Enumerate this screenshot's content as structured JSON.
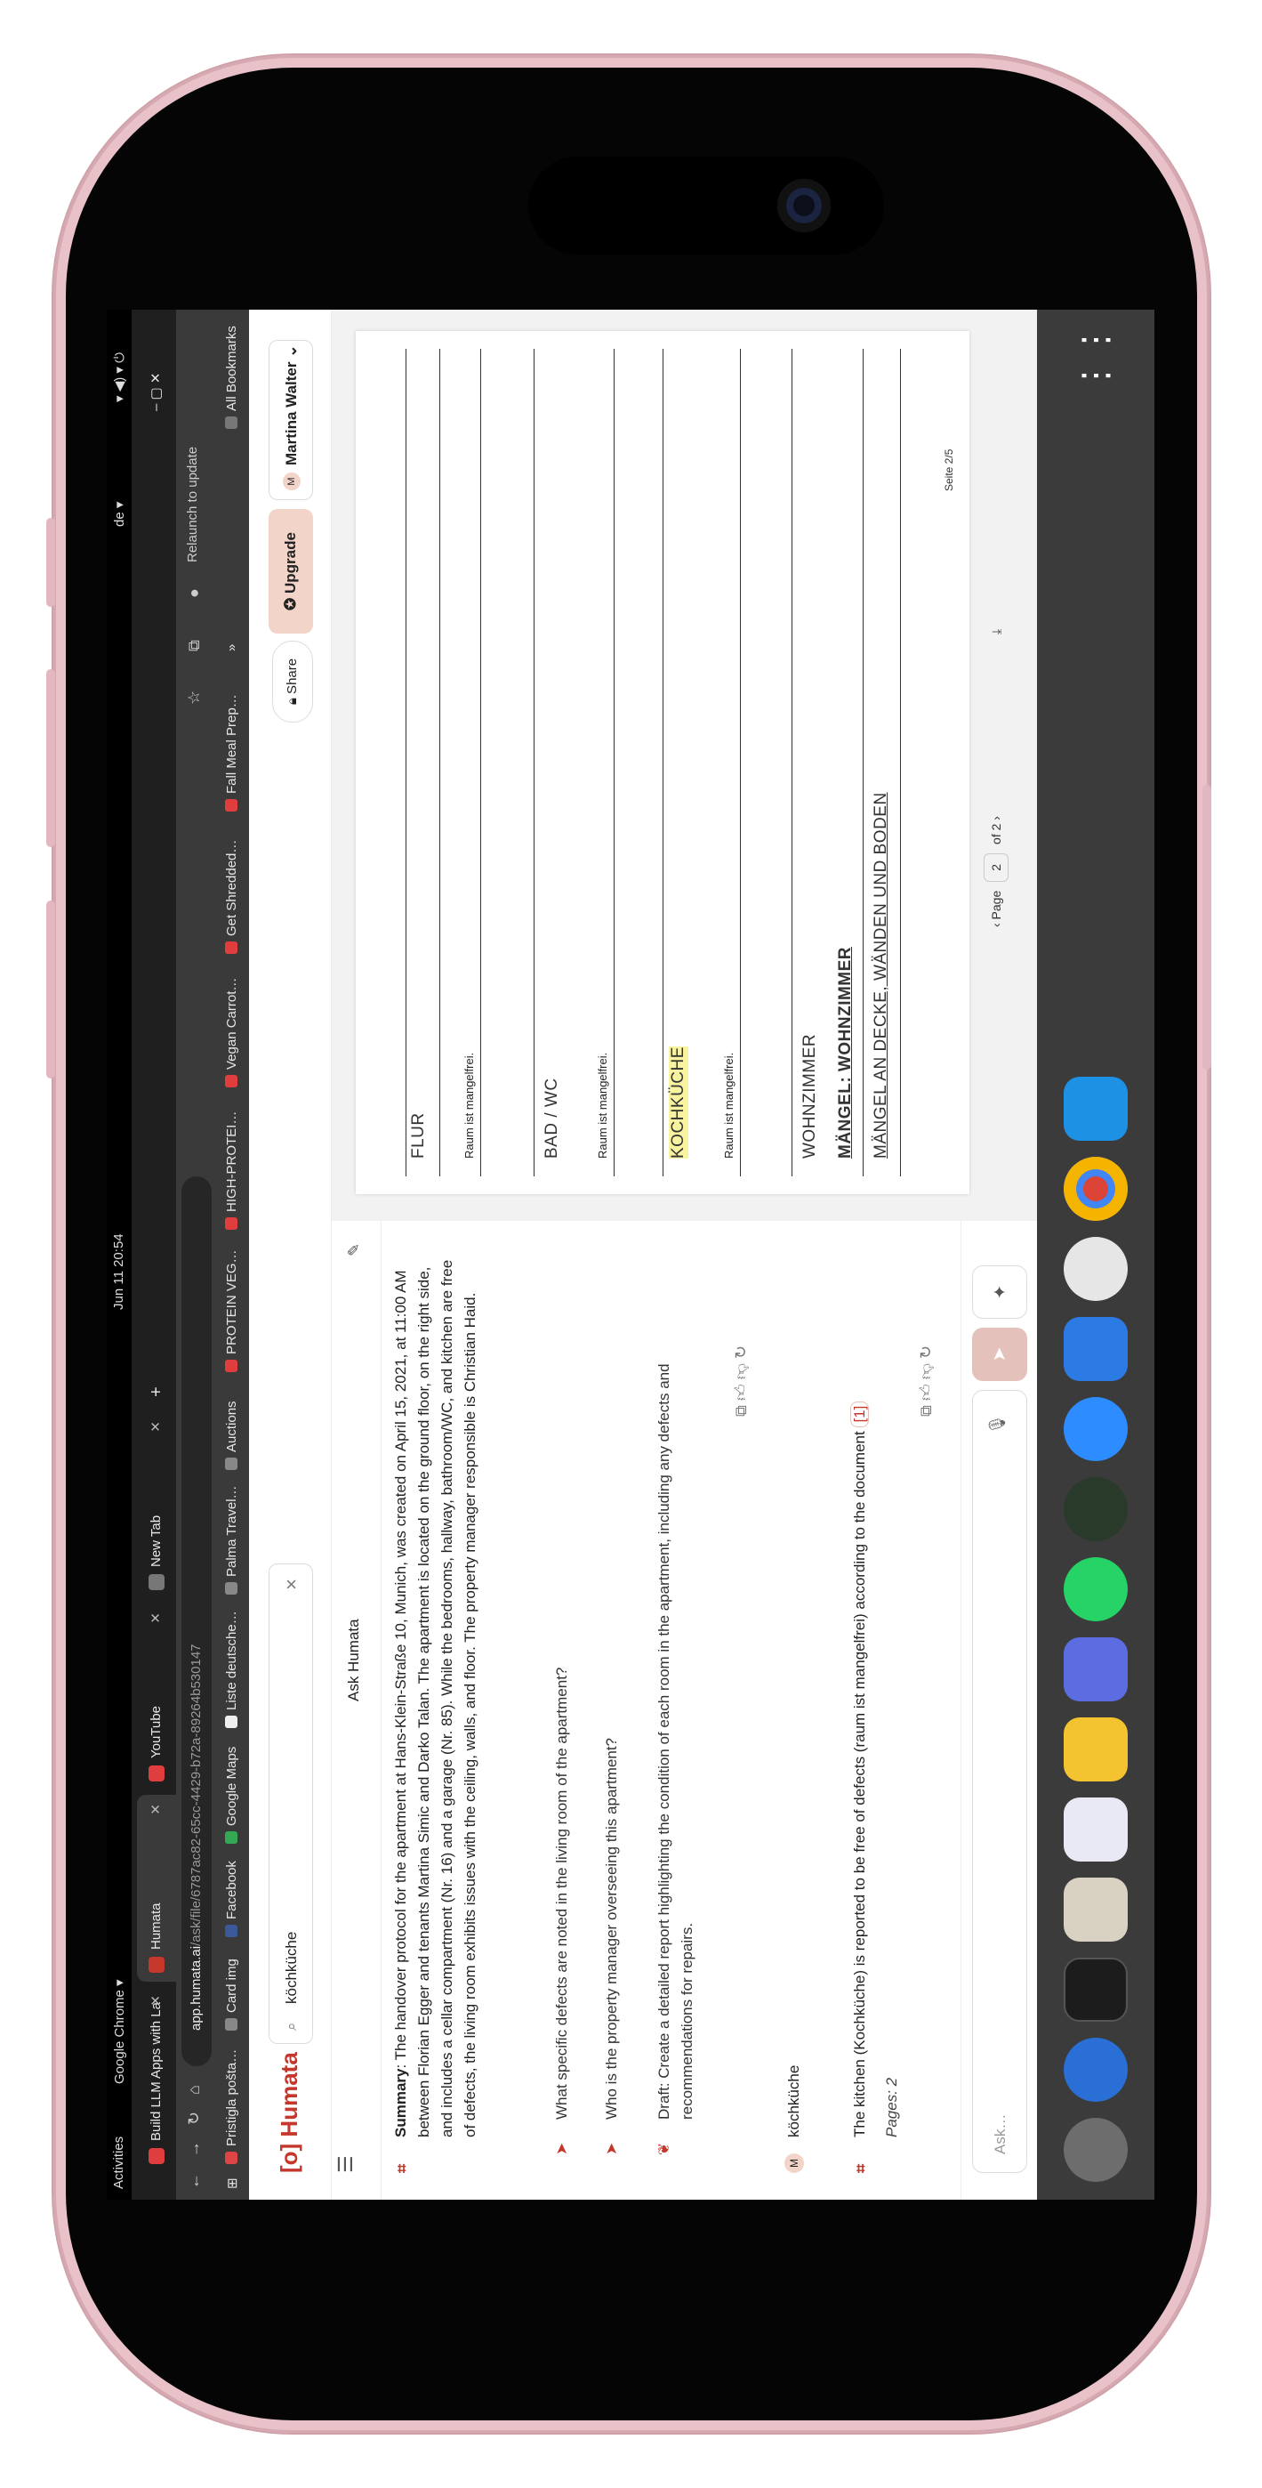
{
  "system": {
    "activities": "Activities",
    "app_menu": "Google Chrome ▾",
    "datetime": "Jun 11  20:54",
    "locale": "de ▾"
  },
  "tabs": [
    {
      "label": "Build LLM Apps with La",
      "color": "#e03e3e"
    },
    {
      "label": "Humata",
      "color": "#c4372a"
    },
    {
      "label": "YouTube",
      "color": "#e03e3e"
    },
    {
      "label": "New Tab",
      "color": "#777777"
    }
  ],
  "toolbar": {
    "url_host": "app.humata.ai",
    "url_path": "/ask/file/6787ac82-65cc-4429-b72a-89264b530147",
    "relaunch": "Relaunch to update"
  },
  "bookmarks": [
    "Pristigla pošta…",
    "Card img",
    "Facebook",
    "Google Maps",
    "Liste deutsche…",
    "Palma Travel…",
    "Auctions",
    "PROTEIN VEG…",
    "HIGH-PROTEI…",
    "Vegan Carrot…",
    "Get Shredded…",
    "Fall Meal Prep…",
    "All Bookmarks"
  ],
  "header": {
    "logo": "Humata",
    "search_value": "köchküche",
    "share": "Share",
    "upgrade": "Upgrade",
    "user": "Martina Walter",
    "user_initial": "M"
  },
  "chat": {
    "title": "Ask Humata",
    "summary_label": "Summary",
    "summary_text": ": The handover protocol for the apartment at Hans-Klein-Straße 10, Munich, was created on April 15, 2021, at 11:00 AM between Florian Egger and tenants Martina Simic and Darko Talan. The apartment is located on the ground floor, on the right side, and includes a cellar compartment (Nr. 16) and a garage (Nr. 85). While the bedrooms, hallway, bathroom/WC, and kitchen are free of defects, the living room exhibits issues with the ceiling, walls, and floor. The property manager responsible is Christian Haid.",
    "suggestions": [
      "What specific defects are noted in the living room of the apartment?",
      "Who is the property manager overseeing this apartment?",
      "Draft: Create a detailed report highlighting the condition of each room in the apartment, including any defects and recommendations for repairs."
    ],
    "user_query": "köchküche",
    "answer": "The kitchen (Kochküche) is reported to be free of defects (raum ist mangelfrei) according to the document",
    "answer_ref": "[1]",
    "answer_pages": "Pages: 2",
    "input_placeholder": "Ask…"
  },
  "document": {
    "sections": [
      "FLUR",
      "BAD / WC",
      "KOCHKÜCHE",
      "WOHNZIMMER"
    ],
    "notes": [
      "Raum ist mangelfrei.",
      "Raum ist mangelfrei.",
      "Raum ist mangelfrei."
    ],
    "defect_heading": "MÄNGEL: WOHNZIMMER",
    "defect_sub": "MÄNGEL AN DECKE, WÄNDEN UND BODEN",
    "page_label": "Seite 2/5",
    "page_word": "Page",
    "page_current": "2",
    "page_total": "of 2"
  }
}
